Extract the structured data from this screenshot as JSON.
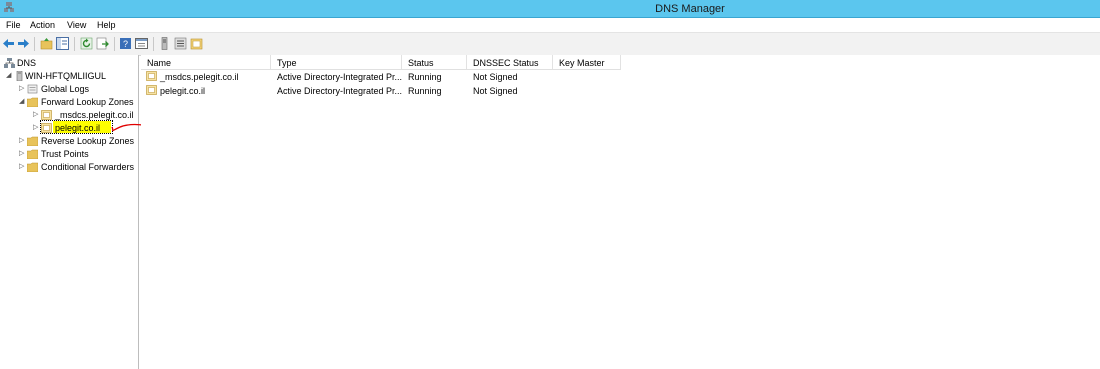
{
  "window": {
    "title": "DNS Manager"
  },
  "menu": {
    "items": [
      "File",
      "Action",
      "View",
      "Help"
    ]
  },
  "toolbar": {
    "buttons": [
      "back-icon",
      "forward-icon",
      "up-folder-icon",
      "show-hide-tree-icon",
      "refresh-icon",
      "export-list-icon",
      "help-icon",
      "properties-icon",
      "server-icon",
      "list-icon",
      "new-zone-icon"
    ]
  },
  "tree": {
    "root": "DNS",
    "server": "WIN-HFTQMLIIGUL",
    "global_logs": "Global Logs",
    "forward_zones": "Forward Lookup Zones",
    "msdcs_zone": "_msdcs.pelegit.co.il",
    "pelegit_zone": "pelegit.co.il",
    "reverse_zones": "Reverse Lookup Zones",
    "trust_points": "Trust Points",
    "conditional_forwarders": "Conditional Forwarders"
  },
  "list": {
    "columns": [
      "Name",
      "Type",
      "Status",
      "DNSSEC Status",
      "Key Master"
    ],
    "rows": [
      {
        "name": "_msdcs.pelegit.co.il",
        "type": "Active Directory-Integrated Pr...",
        "status": "Running",
        "dnssec": "Not Signed",
        "key_master": ""
      },
      {
        "name": "pelegit.co.il",
        "type": "Active Directory-Integrated Pr...",
        "status": "Running",
        "dnssec": "Not Signed",
        "key_master": ""
      }
    ]
  },
  "colors": {
    "titlebar": "#5bc6ee",
    "highlight": "#ffff00",
    "annotation": "#e00000",
    "folder": "#e8c35a"
  }
}
